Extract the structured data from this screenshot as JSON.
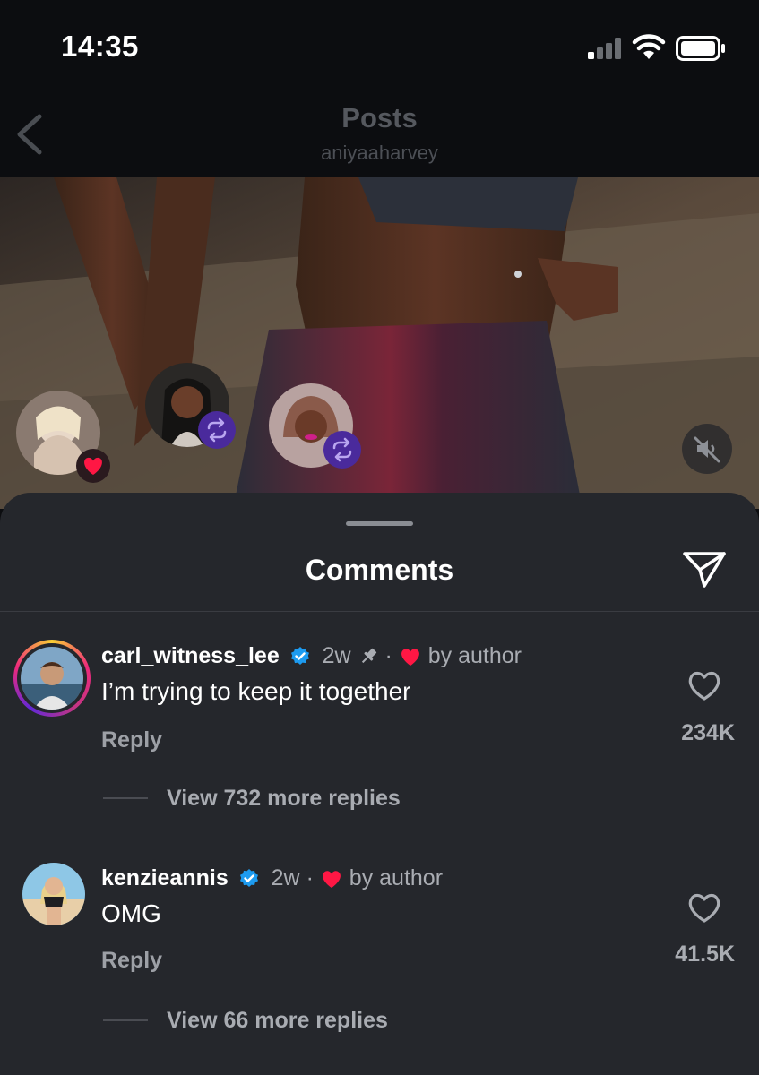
{
  "status": {
    "time": "14:35"
  },
  "header": {
    "title": "Posts",
    "username": "aniyaaharvey",
    "back_icon": "chevron-left-icon"
  },
  "media": {
    "mute_icon": "speaker-muted-icon"
  },
  "sheet": {
    "title": "Comments",
    "share_icon": "send-icon"
  },
  "comments": [
    {
      "username": "carl_witness_lee",
      "verified": true,
      "age": "2w",
      "pinned": true,
      "liked_by": "by author",
      "text": "I’m trying to keep it together",
      "reply_label": "Reply",
      "likes": "234K",
      "view_replies": "View 732 more replies"
    },
    {
      "username": "kenzieannis",
      "verified": true,
      "age": "2w",
      "pinned": false,
      "liked_by": "by author",
      "text": "OMG",
      "reply_label": "Reply",
      "likes": "41.5K",
      "view_replies": "View 66 more replies"
    }
  ],
  "colors": {
    "accent_verified": "#1d9bf0",
    "heart": "#ff1744",
    "repost_badge": "#5b2fb8",
    "sheet_bg": "#25272c"
  }
}
